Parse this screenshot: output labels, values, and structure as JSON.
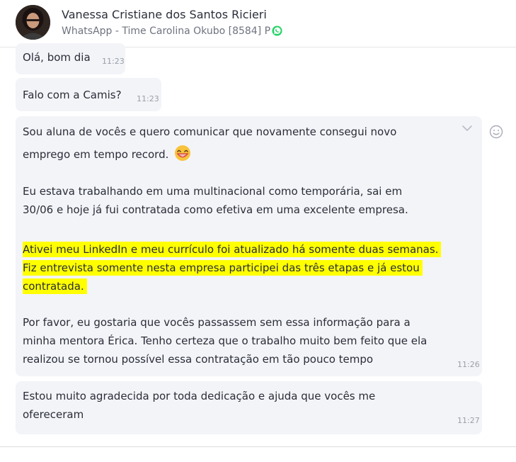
{
  "header": {
    "contact_name": "Vanessa Cristiane dos Santos Ricieri",
    "channel": "WhatsApp - Time Carolina Okubo [8584] P"
  },
  "messages": [
    {
      "text": "Olá, bom dia",
      "time": "11:23"
    },
    {
      "text": "Falo com a Camis?",
      "time": "11:23"
    },
    {
      "time": "11:26",
      "lines": [
        "Sou aluna de vocês e quero comunicar que novamente consegui novo",
        "emprego em tempo record.",
        "Eu estava trabalhando em uma multinacional como temporária, sai em",
        "30/06 e hoje já fui contratada como efetiva em uma excelente empresa.",
        "Ativei meu LinkedIn e meu currículo foi atualizado há somente duas semanas.",
        "Fiz entrevista somente nesta empresa participei das três etapas e já estou",
        "contratada.",
        "Por favor, eu gostaria que vocês passassem sem essa informação para a",
        "minha mentora Érica. Tenho certeza que o trabalho muito bem feito que ela",
        "realizou se tornou possível essa contratação em tão pouco tempo"
      ],
      "emoji": "😁"
    },
    {
      "time": "11:27",
      "lines": [
        "Estou muito agradecida por toda dedicação e ajuda que vocês me",
        "ofereceram"
      ]
    }
  ]
}
